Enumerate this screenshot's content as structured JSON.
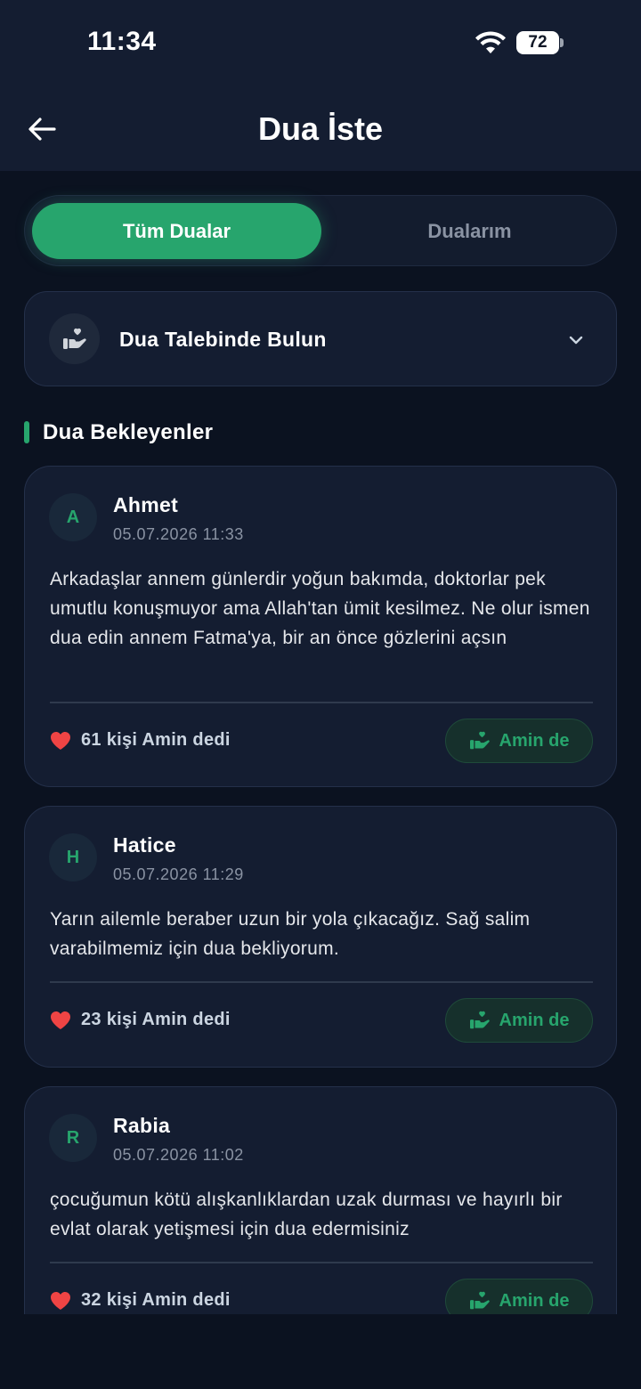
{
  "status": {
    "time": "11:34",
    "battery": "72"
  },
  "header": {
    "title": "Dua İste"
  },
  "tabs": [
    {
      "label": "Tüm Dualar",
      "active": true
    },
    {
      "label": "Dualarım",
      "active": false
    }
  ],
  "request": {
    "label": "Dua Talebinde Bulun"
  },
  "section": {
    "title": "Dua Bekleyenler"
  },
  "prayers": [
    {
      "initial": "A",
      "name": "Ahmet",
      "date": "05.07.2026 11:33",
      "text": "Arkadaşlar annem günlerdir yoğun bakımda, doktorlar pek umutlu konuşmuyor ama Allah'tan ümit kesilmez. Ne olur ismen dua edin annem Fatma'ya, bir an önce gözlerini açsın",
      "amen_count": "61 kişi Amin dedi",
      "button_label": "Amin de"
    },
    {
      "initial": "H",
      "name": "Hatice",
      "date": "05.07.2026 11:29",
      "text": "Yarın ailemle beraber uzun bir yola çıkacağız. Sağ salim varabilmemiz için dua bekliyorum.",
      "amen_count": "23 kişi Amin dedi",
      "button_label": "Amin de"
    },
    {
      "initial": "R",
      "name": "Rabia",
      "date": "05.07.2026 11:02",
      "text": "çocuğumun kötü alışkanlıklardan uzak durması ve hayırlı bir evlat olarak yetişmesi için dua edermisiniz",
      "amen_count": "32 kişi Amin dedi",
      "button_label": "Amin de"
    }
  ],
  "colors": {
    "accent": "#27a56d",
    "background": "#0b1220",
    "card": "#141d31",
    "heart": "#ef4444"
  }
}
